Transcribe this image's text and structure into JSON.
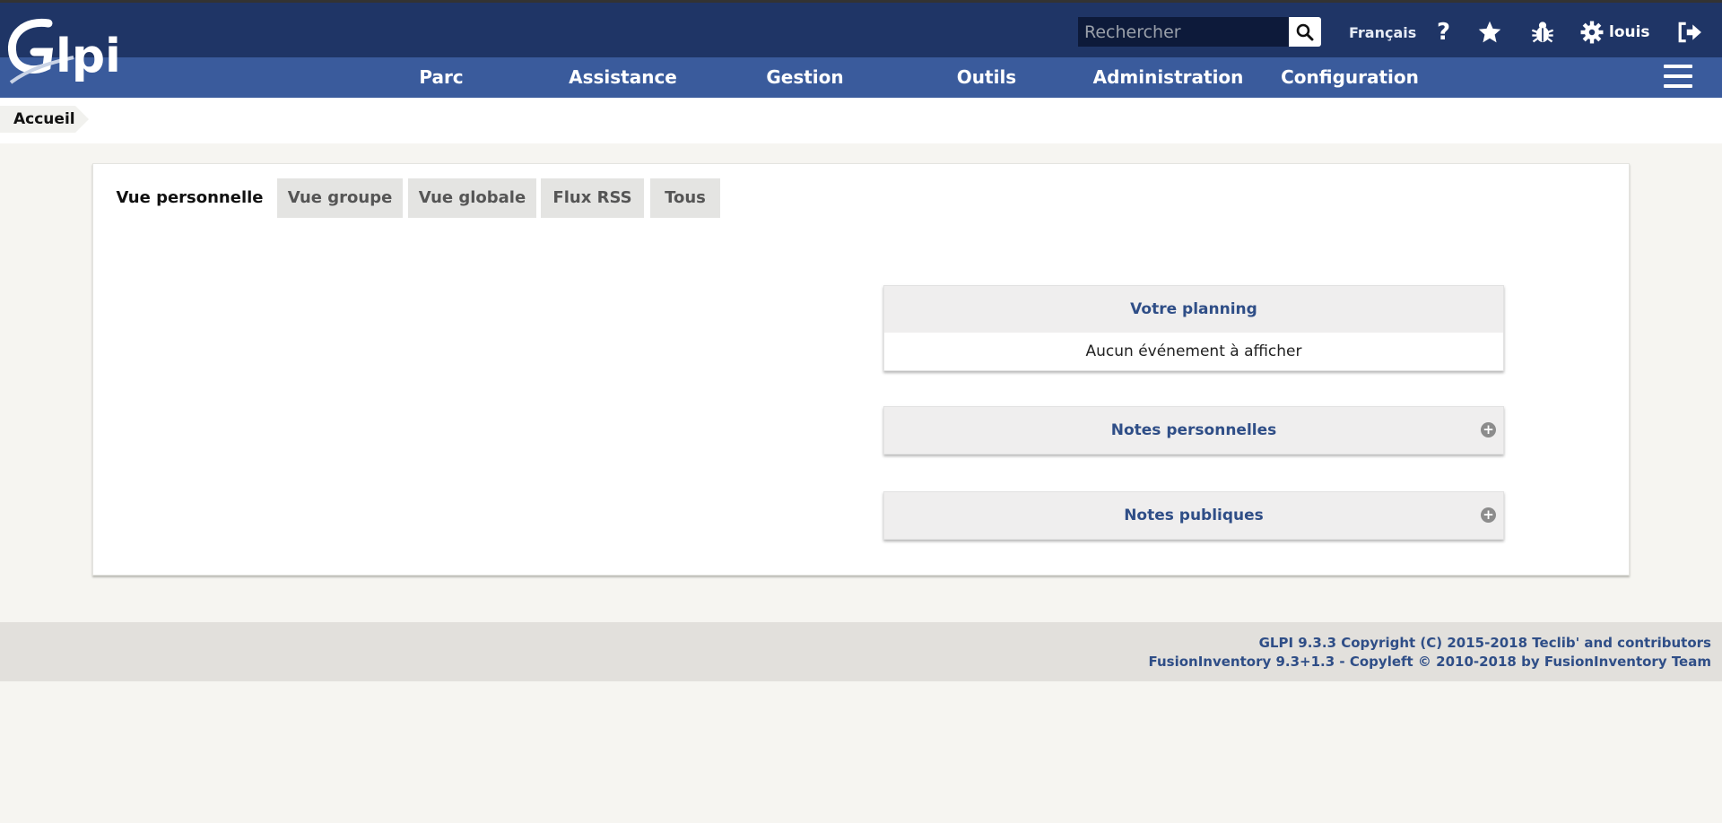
{
  "header": {
    "logo_text": "Glpi",
    "search_placeholder": "Rechercher",
    "language": "Français",
    "user": "louis"
  },
  "menu": {
    "items": [
      "Parc",
      "Assistance",
      "Gestion",
      "Outils",
      "Administration",
      "Configuration"
    ]
  },
  "breadcrumb": {
    "home": "Accueil"
  },
  "tabs": [
    "Vue personnelle",
    "Vue groupe",
    "Vue globale",
    "Flux RSS",
    "Tous"
  ],
  "cards": {
    "planning": {
      "title": "Votre planning",
      "body": "Aucun événement à afficher"
    },
    "personal_notes": {
      "title": "Notes personnelles"
    },
    "public_notes": {
      "title": "Notes publiques"
    }
  },
  "footer": {
    "line1": "GLPI 9.3.3 Copyright (C) 2015-2018 Teclib' and contributors",
    "line2": "FusionInventory 9.3+1.3 - Copyleft © 2010-2018 by FusionInventory Team"
  },
  "colors": {
    "header_dark": "#1f3566",
    "menu_bar": "#3a5b9c",
    "accent_text": "#2f4e87",
    "page_bg": "#f6f5f1"
  }
}
